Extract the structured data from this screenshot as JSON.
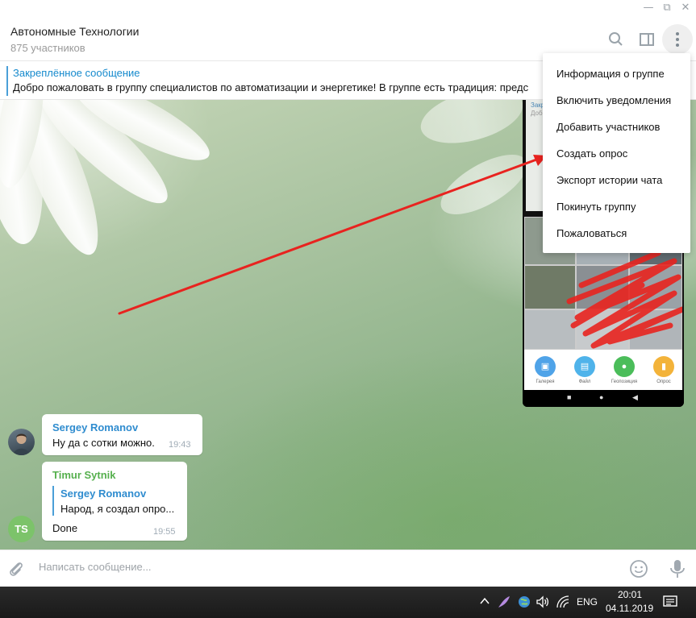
{
  "window": {
    "minimize": "—",
    "maximize": "⧉",
    "close": "✕"
  },
  "header": {
    "title": "Автономные Технологии",
    "subtitle": "875 участников",
    "icons": [
      "search-icon",
      "sidebar-toggle-icon",
      "more-vertical-icon"
    ]
  },
  "pinned": {
    "title": "Закреплённое сообщение",
    "text": "Добро пожаловать в группу специалистов по автоматизации и энергетике! В группе есть традиция: предс"
  },
  "menu": {
    "items": [
      "Информация о группе",
      "Включить уведомления",
      "Добавить участников",
      "Создать опрос",
      "Экспорт истории чата",
      "Покинуть группу",
      "Пожаловаться"
    ]
  },
  "phone": {
    "top_label": "Закр",
    "top_label2": "Добр",
    "apps": [
      {
        "label": "Галерея",
        "color": "#4fa3e8",
        "icon": "gallery-icon"
      },
      {
        "label": "Файл",
        "color": "#4fb3ea",
        "icon": "file-icon"
      },
      {
        "label": "Геопозиция",
        "color": "#4bbd5a",
        "icon": "location-icon"
      },
      {
        "label": "Опрос",
        "color": "#f3b33a",
        "icon": "poll-icon"
      }
    ],
    "nav": [
      "■",
      "●",
      "◀"
    ]
  },
  "messages": [
    {
      "author": "Sergey Romanov",
      "author_color": "#2f8ccf",
      "text": "Ну да с сотки можно.",
      "time": "19:43"
    },
    {
      "author": "Timur Sytnik",
      "author_color": "#56b04e",
      "reply_author": "Sergey Romanov",
      "reply_text": "Народ, я создал опро...",
      "text": "Done",
      "time": "19:55",
      "avatar_initials": "TS"
    }
  ],
  "composer": {
    "placeholder": "Написать сообщение..."
  },
  "taskbar": {
    "lang": "ENG",
    "time": "20:01",
    "date": "04.11.2019"
  },
  "colors": {
    "accent": "#168acd",
    "arrow": "#e8231f",
    "avatar_ts": "#7cc36a"
  }
}
